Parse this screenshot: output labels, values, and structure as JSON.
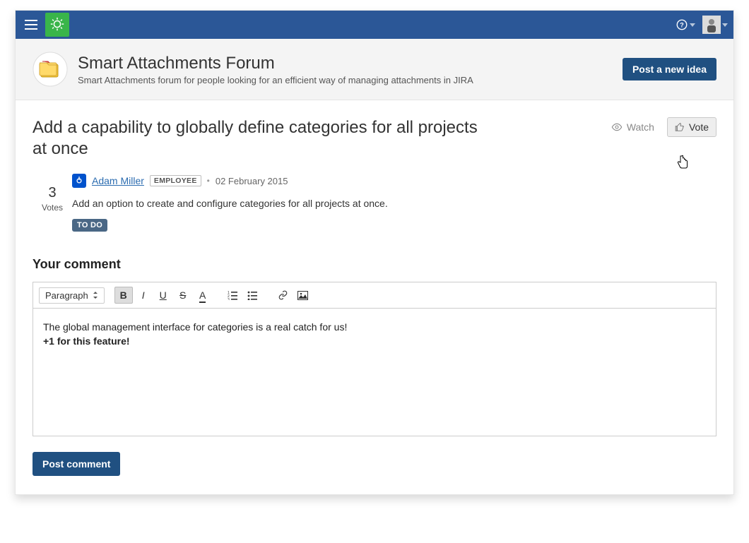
{
  "banner": {
    "title": "Smart Attachments Forum",
    "subtitle": "Smart Attachments forum for people looking for an efficient way of managing attachments in JIRA",
    "post_button": "Post a new idea"
  },
  "idea": {
    "title": "Add a capability to globally define categories for all projects at once",
    "watch_label": "Watch",
    "vote_label": "Vote",
    "votes_count": "3",
    "votes_label": "Votes",
    "author_name": "Adam Miller",
    "employee_badge": "EMPLOYEE",
    "date": "02 February 2015",
    "description": "Add an option to create and configure categories for all projects at once.",
    "status": "TO DO"
  },
  "comment_section": {
    "heading": "Your comment",
    "style_dropdown": "Paragraph",
    "editor_line1": "The global management interface for categories is a real catch for us!",
    "editor_line2": "+1 for this feature!",
    "post_button": "Post comment"
  },
  "icons": {
    "hamburger": "hamburger-icon",
    "logo": "lightbulb-icon",
    "help": "help-icon",
    "user": "user-avatar",
    "watch_eye": "eye-icon",
    "thumbs": "thumbs-up-icon"
  }
}
